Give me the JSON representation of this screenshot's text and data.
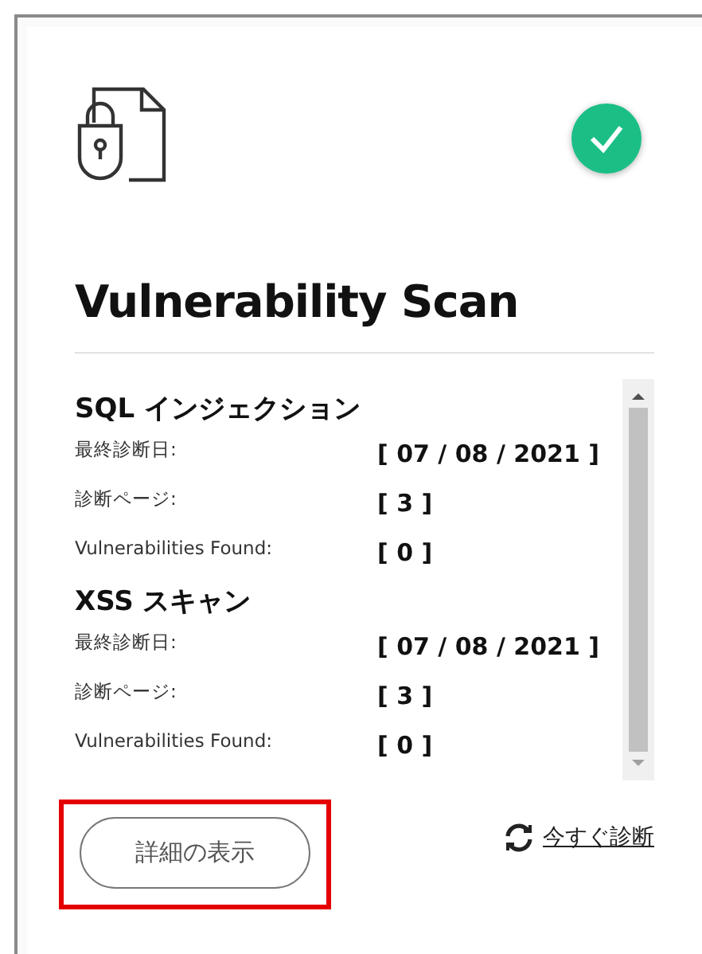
{
  "card": {
    "title": "Vulnerability Scan",
    "passed": true
  },
  "sections": [
    {
      "heading": "SQL インジェクション",
      "rows": [
        {
          "label": "最終診断日:",
          "value": "[ 07 / 08 / 2021 ]"
        },
        {
          "label": "診断ページ:",
          "value": "[ 3 ]"
        },
        {
          "label": "Vulnerabilities Found:",
          "value": "[ 0 ]"
        }
      ]
    },
    {
      "heading": "XSS スキャン",
      "rows": [
        {
          "label": "最終診断日:",
          "value": "[ 07 / 08 / 2021 ]"
        },
        {
          "label": "診断ページ:",
          "value": "[ 3 ]"
        },
        {
          "label": "Vulnerabilities Found:",
          "value": "[ 0 ]"
        }
      ]
    }
  ],
  "details_button": {
    "label": "詳細の表示",
    "highlighted": true
  },
  "scan_link": {
    "label": "今すぐ診断"
  }
}
